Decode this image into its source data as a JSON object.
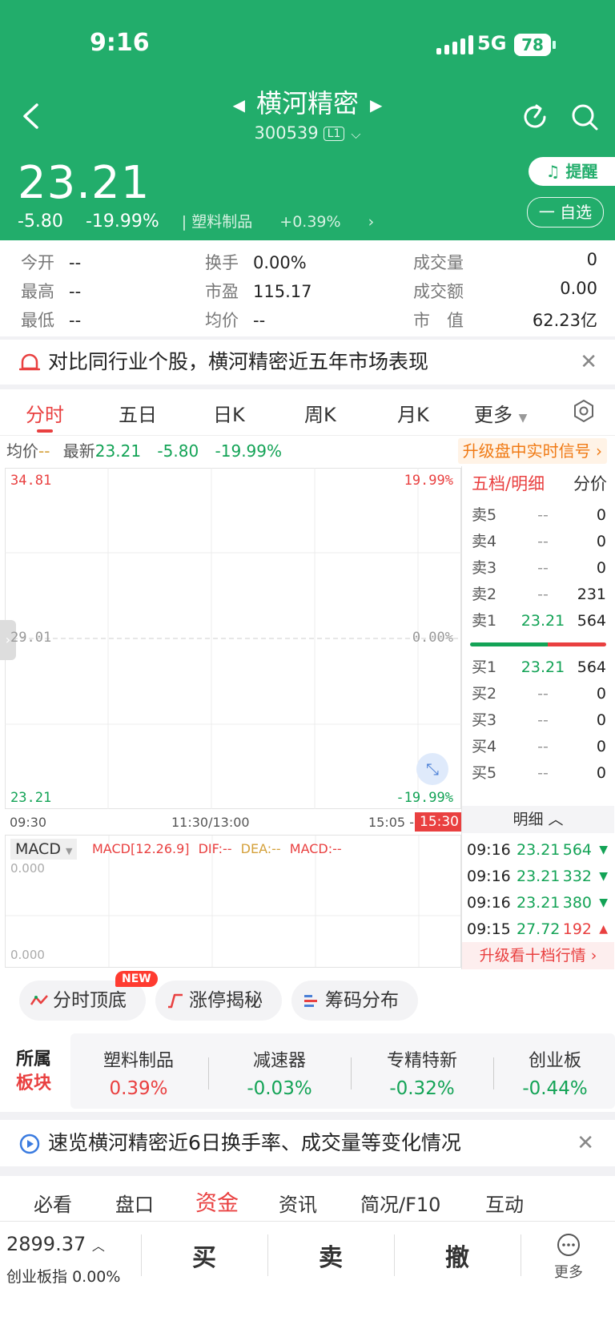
{
  "status_bar": {
    "time": "9:16",
    "network": "5G",
    "battery": "78"
  },
  "header": {
    "stock_name": "横河精密",
    "stock_code": "300539",
    "level_badge": "L1",
    "price": "23.21",
    "change": "-5.80",
    "change_pct": "-19.99%",
    "industry": "塑料制品",
    "industry_change": "+0.39%",
    "remind_label": "提醒",
    "watch_label": "一 自选"
  },
  "stats": [
    {
      "label": "今开",
      "value": "--"
    },
    {
      "label": "换手",
      "value": "0.00%"
    },
    {
      "label": "成交量",
      "value": "0"
    },
    {
      "label": "最高",
      "value": "--"
    },
    {
      "label": "市盈",
      "value": "115.17"
    },
    {
      "label": "成交额",
      "value": "0.00"
    },
    {
      "label": "最低",
      "value": "--"
    },
    {
      "label": "均价",
      "value": "--"
    },
    {
      "label": "市　值",
      "value": "62.23亿"
    }
  ],
  "banner": {
    "text": "对比同行业个股，横河精密近五年市场表现"
  },
  "tabs": [
    "分时",
    "五日",
    "日K",
    "周K",
    "月K",
    "更多"
  ],
  "info_bar": {
    "avg_label": "均价",
    "avg_value": "--",
    "latest_label": "最新",
    "latest_value": "23.21",
    "change": "-5.80",
    "change_pct": "-19.99%",
    "upgrade_link": "升级盘中实时信号"
  },
  "chart": {
    "price_top": "34.81",
    "price_mid": "29.01",
    "price_bottom": "23.21",
    "pct_top": "19.99%",
    "pct_mid": "0.00%",
    "pct_bottom": "-19.99%",
    "time_start": "09:30",
    "time_mid": "11:30/13:00",
    "time_pre_end": "15:05 -",
    "time_end": "15:30",
    "macd_selector": "MACD",
    "macd_params": "MACD[12.26.9]",
    "dif": "DIF:--",
    "dea": "DEA:--",
    "macd": "MACD:--",
    "macd_top": "0.000",
    "macd_bottom": "0.000"
  },
  "order_book": {
    "tab_active": "五档/明细",
    "tab_other": "分价",
    "asks": [
      {
        "label": "卖5",
        "price": "--",
        "vol": "0"
      },
      {
        "label": "卖4",
        "price": "--",
        "vol": "0"
      },
      {
        "label": "卖3",
        "price": "--",
        "vol": "0"
      },
      {
        "label": "卖2",
        "price": "--",
        "vol": "231"
      },
      {
        "label": "卖1",
        "price": "23.21",
        "vol": "564"
      }
    ],
    "bids": [
      {
        "label": "买1",
        "price": "23.21",
        "vol": "564"
      },
      {
        "label": "买2",
        "price": "--",
        "vol": "0"
      },
      {
        "label": "买3",
        "price": "--",
        "vol": "0"
      },
      {
        "label": "买4",
        "price": "--",
        "vol": "0"
      },
      {
        "label": "买5",
        "price": "--",
        "vol": "0"
      }
    ],
    "detail_label": "明细",
    "ticks": [
      {
        "time": "09:16",
        "price": "23.21",
        "vol": "564"
      },
      {
        "time": "09:16",
        "price": "23.21",
        "vol": "332"
      },
      {
        "time": "09:16",
        "price": "23.21",
        "vol": "380"
      },
      {
        "time": "09:15",
        "price": "27.72",
        "vol": "192"
      }
    ],
    "upgrade": "升级看十档行情"
  },
  "chips": [
    {
      "label": "分时顶底",
      "badge": "NEW"
    },
    {
      "label": "涨停揭秘"
    },
    {
      "label": "筹码分布"
    }
  ],
  "sector": {
    "label_line1": "所属",
    "label_line2": "板块",
    "items": [
      {
        "name": "塑料制品",
        "change": "0.39%"
      },
      {
        "name": "减速器",
        "change": "-0.03%"
      },
      {
        "name": "专精特新",
        "change": "-0.32%"
      },
      {
        "name": "创业板",
        "change": "-0.44%"
      }
    ]
  },
  "banner2": {
    "text": "速览横河精密近6日换手率、成交量等变化情况"
  },
  "sub_tabs": [
    "必看",
    "盘口",
    "资金",
    "资讯",
    "简况/F10",
    "互动"
  ],
  "bottom": {
    "index_value": "2899.37",
    "index_name": "创业板指",
    "index_change": "0.00%",
    "buy": "买",
    "sell": "卖",
    "cancel": "撤",
    "more": "更多"
  }
}
